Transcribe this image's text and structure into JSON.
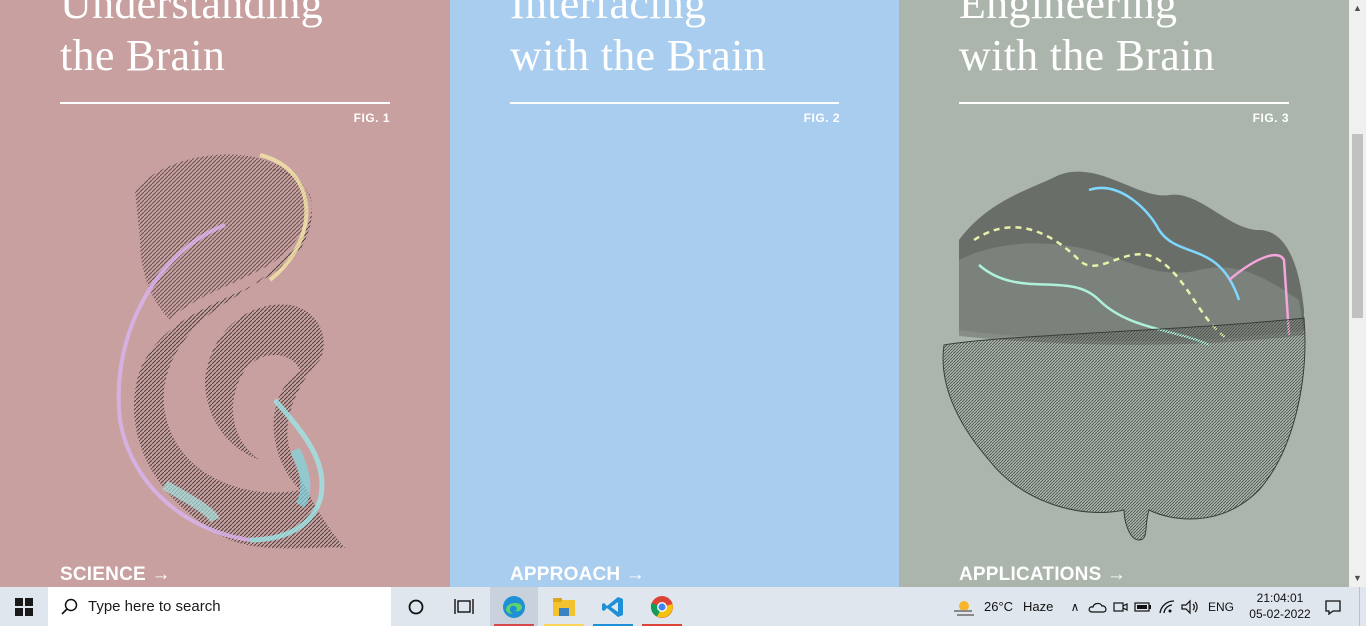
{
  "panels": [
    {
      "title_line1": "Understanding",
      "title_line2": "the Brain",
      "fig": "FIG. 1",
      "cta": "SCIENCE →"
    },
    {
      "title_line1": "Interfacing",
      "title_line2": "with the Brain",
      "fig": "FIG. 2",
      "cta": "APPROACH →"
    },
    {
      "title_line1": "Engineering",
      "title_line2": "with the Brain",
      "fig": "FIG. 3",
      "cta": "APPLICATIONS →"
    }
  ],
  "taskbar": {
    "search_placeholder": "Type here to search",
    "weather_temp": "26°C",
    "weather_desc": "Haze",
    "language": "ENG",
    "time": "21:04:01",
    "date": "05-02-2022",
    "apps": [
      "task-view",
      "edge",
      "file-explorer",
      "vscode",
      "chrome"
    ]
  },
  "colors": {
    "panel1": "#c9a0a0",
    "panel2": "#a9cdee",
    "panel3": "#abb5ab",
    "taskbar": "#dfe6ee"
  }
}
